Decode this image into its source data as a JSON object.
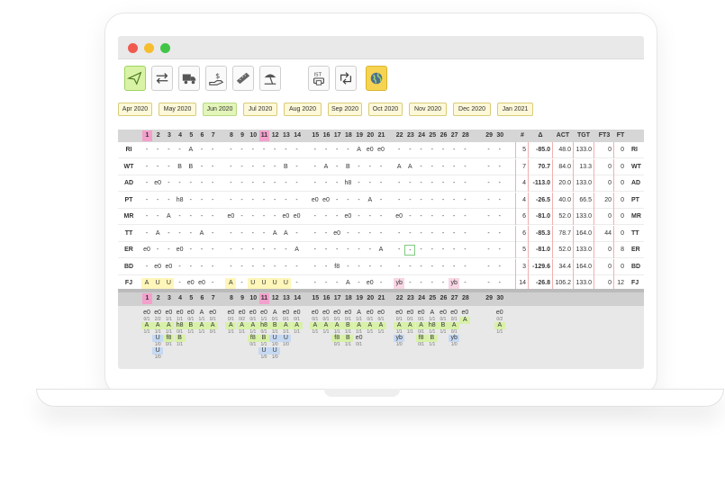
{
  "window": {
    "dot_colors": [
      "#f05a4f",
      "#f6bd2e",
      "#42c547"
    ]
  },
  "toolbar": {
    "buttons": [
      {
        "name": "send-icon",
        "active": true
      },
      {
        "name": "swap-arrows-icon",
        "active": false
      },
      {
        "name": "truck-icon",
        "active": false
      },
      {
        "name": "money-hand-icon",
        "active": false
      },
      {
        "name": "ruler-icon",
        "active": false
      },
      {
        "name": "beach-umbrella-icon",
        "active": false
      },
      {
        "name": "ist-printer-icon",
        "active": false,
        "label": "IST"
      },
      {
        "name": "retweet-arrows-icon",
        "active": false
      },
      {
        "name": "globe-icon",
        "active": true
      }
    ]
  },
  "months": [
    "Apr 2020",
    "May 2020",
    "Jun 2020",
    "Jul 2020",
    "Aug 2020",
    "Sep 2020",
    "Oct 2020",
    "Nov 2020",
    "Dec 2020",
    "Jan 2021"
  ],
  "active_month": "Jun 2020",
  "days": [
    "1",
    "2",
    "3",
    "4",
    "5",
    "6",
    "7",
    "8",
    "9",
    "10",
    "11",
    "12",
    "13",
    "14",
    "15",
    "16",
    "17",
    "18",
    "19",
    "20",
    "21",
    "22",
    "23",
    "24",
    "25",
    "26",
    "27",
    "28",
    "29",
    "30"
  ],
  "highlight_days": [
    "1",
    "11"
  ],
  "stats_headers": [
    "#",
    "Δ",
    "ACT",
    "TGT",
    "FT3",
    "FT"
  ],
  "rows": [
    {
      "label": "RI",
      "cells": [
        "-",
        "-",
        "-",
        "-",
        "A",
        "-",
        "-",
        "-",
        "-",
        "-",
        "-",
        "-",
        "-",
        "-",
        "-",
        "-",
        "-",
        "-",
        "A",
        "e0",
        "e0",
        "-",
        "-",
        "-",
        "-",
        "-",
        "-",
        "-",
        "-",
        "-"
      ],
      "stats": [
        "5",
        "-85.0",
        "48.0",
        "133.0",
        "0",
        "0"
      ]
    },
    {
      "label": "WT",
      "cells": [
        "-",
        "-",
        "-",
        "B",
        "B",
        "-",
        "-",
        "-",
        "-",
        "-",
        "-",
        "-",
        "B",
        "-",
        "-",
        "A",
        "-",
        "B",
        "-",
        "-",
        "-",
        "A",
        "A",
        "-",
        "-",
        "-",
        "-",
        "-",
        "-",
        "-"
      ],
      "stats": [
        "7",
        "70.7",
        "84.0",
        "13.3",
        "0",
        "0"
      ]
    },
    {
      "label": "AD",
      "cells": [
        "-",
        "e0",
        "-",
        "-",
        "-",
        "-",
        "-",
        "-",
        "-",
        "-",
        "-",
        "-",
        "-",
        "-",
        "-",
        "-",
        "-",
        "h8",
        "-",
        "-",
        "-",
        "-",
        "-",
        "-",
        "-",
        "-",
        "-",
        "-",
        "-",
        "-"
      ],
      "stats": [
        "4",
        "-113.0",
        "20.0",
        "133.0",
        "0",
        "0"
      ]
    },
    {
      "label": "PT",
      "cells": [
        "-",
        "-",
        "-",
        "h8",
        "-",
        "-",
        "-",
        "-",
        "-",
        "-",
        "-",
        "-",
        "-",
        "-",
        "e0",
        "e0",
        "-",
        "-",
        "-",
        "A",
        "-",
        "-",
        "-",
        "-",
        "-",
        "-",
        "-",
        "-",
        "-",
        "-"
      ],
      "stats": [
        "4",
        "-26.5",
        "40.0",
        "66.5",
        "20",
        "0"
      ]
    },
    {
      "label": "MR",
      "cells": [
        "-",
        "-",
        "A",
        "-",
        "-",
        "-",
        "-",
        "e0",
        "-",
        "-",
        "-",
        "-",
        "e0",
        "e0",
        "-",
        "-",
        "-",
        "e0",
        "-",
        "-",
        "-",
        "e0",
        "-",
        "-",
        "-",
        "-",
        "-",
        "-",
        "-",
        "-"
      ],
      "stats": [
        "6",
        "-81.0",
        "52.0",
        "133.0",
        "0",
        "0"
      ]
    },
    {
      "label": "TT",
      "cells": [
        "-",
        "A",
        "-",
        "-",
        "-",
        "A",
        "-",
        "-",
        "-",
        "-",
        "-",
        "A",
        "A",
        "-",
        "-",
        "-",
        "e0",
        "-",
        "-",
        "-",
        "-",
        "-",
        "-",
        "-",
        "-",
        "-",
        "-",
        "-",
        "-",
        "-"
      ],
      "stats": [
        "6",
        "-85.3",
        "78.7",
        "164.0",
        "44",
        "0"
      ]
    },
    {
      "label": "ER",
      "cells": [
        "e0",
        "-",
        "-",
        "e0",
        "-",
        "-",
        "-",
        "-",
        "-",
        "-",
        "-",
        "-",
        "-",
        "A",
        "-",
        "-",
        "-",
        "-",
        "-",
        "-",
        "A",
        "-",
        "-",
        "-",
        "-",
        "-",
        "-",
        "-",
        "-",
        "-"
      ],
      "stats": [
        "5",
        "-81.0",
        "52.0",
        "133.0",
        "0",
        "8"
      ]
    },
    {
      "label": "BD",
      "cells": [
        "-",
        "e0",
        "e0",
        "-",
        "-",
        "-",
        "-",
        "-",
        "-",
        "-",
        "-",
        "-",
        "-",
        "-",
        "-",
        "-",
        "f8",
        "-",
        "-",
        "-",
        "-",
        "-",
        "-",
        "-",
        "-",
        "-",
        "-",
        "-",
        "-",
        "-"
      ],
      "stats": [
        "3",
        "-129.6",
        "34.4",
        "164.0",
        "0",
        "0"
      ]
    },
    {
      "label": "FJ",
      "cells": [
        "A",
        "U",
        "U",
        "-",
        "e0",
        "e0",
        "-",
        "A",
        "-",
        "U",
        "U",
        "U",
        "U",
        "-",
        "-",
        "-",
        "-",
        "A",
        "-",
        "e0",
        "-",
        "yb",
        "-",
        "-",
        "-",
        "-",
        "yb",
        "-",
        "-",
        "-"
      ],
      "stats": [
        "14",
        "-26.8",
        "106.2",
        "133.0",
        "0",
        "12"
      ]
    }
  ],
  "summary": {
    "top_codes": [
      "e0",
      "e0",
      "e0",
      "e0",
      "e0",
      "A",
      "e0",
      "e0",
      "e0",
      "e0",
      "e0",
      "A",
      "e0",
      "e0",
      "e0",
      "e0",
      "e0",
      "e0",
      "A",
      "e0",
      "e0",
      "e0",
      "e0",
      "e0",
      "A",
      "e0",
      "e0",
      "e0",
      "",
      "e0"
    ],
    "top_fracs": [
      "0/1",
      "2/2",
      "1/1",
      "1/1",
      "0/1",
      "1/1",
      "0/1",
      "0/1",
      "0/2",
      "0/1",
      "1/1",
      "0/1",
      "0/1",
      "0/1",
      "0/1",
      "0/1",
      "0/1",
      "0/1",
      "1/1",
      "0/1",
      "0/1",
      "0/1",
      "0/1",
      "0/1",
      "1/1",
      "0/1",
      "0/1",
      "",
      "",
      "0/2"
    ],
    "mid_codes": [
      "A",
      "A",
      "A",
      "h8",
      "B",
      "A",
      "A",
      "A",
      "A",
      "A",
      "h8",
      "B",
      "A",
      "A",
      "A",
      "A",
      "A",
      "B",
      "A",
      "A",
      "A",
      "A",
      "A",
      "A",
      "h8",
      "B",
      "A",
      "A",
      "",
      "A"
    ],
    "mid_fracs": [
      "1/1",
      "1/1",
      "1/1",
      "0/1",
      "1/1",
      "1/1",
      "0/1",
      "1/1",
      "1/1",
      "1/1",
      "0/1",
      "1/1",
      "1/1",
      "1/1",
      "1/1",
      "1/1",
      "1/1",
      "1/1",
      "1/1",
      "1/1",
      "1/1",
      "1/1",
      "1/1",
      "0/1",
      "1/1",
      "1/1",
      "0/1",
      "",
      "",
      "1/1"
    ],
    "low_codes": [
      "",
      "U",
      "f8",
      "B",
      "",
      "",
      "",
      "",
      "",
      "f8",
      "B",
      "U",
      "U",
      "",
      "",
      "",
      "f8",
      "B",
      "e0",
      "",
      "",
      "yb",
      "",
      "f8",
      "B",
      "",
      "yb",
      "",
      "",
      ""
    ],
    "low_fracs": [
      "",
      "1/0",
      "0/1",
      "1/1",
      "",
      "",
      "",
      "",
      "",
      "0/1",
      "1/1",
      "1/0",
      "1/0",
      "",
      "",
      "",
      "0/1",
      "1/1",
      "0/1",
      "",
      "",
      "1/0",
      "",
      "0/1",
      "1/1",
      "",
      "1/0",
      "",
      "",
      ""
    ],
    "extra_codes": [
      "",
      "U",
      "",
      "",
      "",
      "",
      "",
      "",
      "",
      "",
      "U",
      "U",
      "",
      "",
      "",
      "",
      "",
      "",
      "",
      "",
      "",
      "",
      "",
      "",
      "",
      "",
      "",
      "",
      "",
      ""
    ],
    "extra_fracs": [
      "",
      "1/0",
      "",
      "",
      "",
      "",
      "",
      "",
      "",
      "",
      "1/0",
      "1/0",
      "",
      "",
      "",
      "",
      "",
      "",
      "",
      "",
      "",
      "",
      "",
      "",
      "",
      "",
      "",
      "",
      "",
      ""
    ]
  }
}
